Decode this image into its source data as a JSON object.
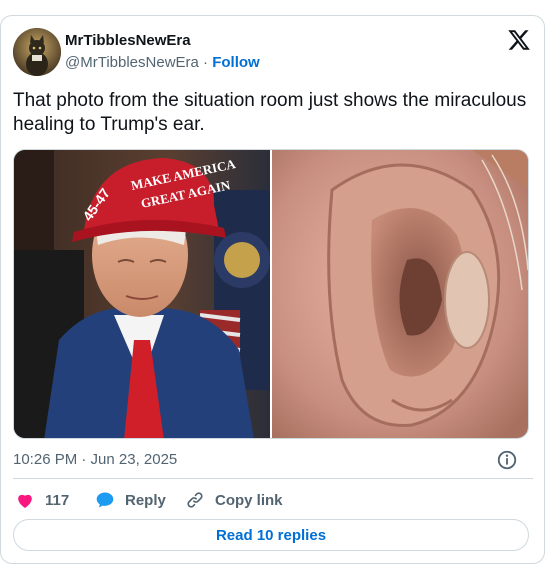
{
  "author": {
    "display_name": "MrTibblesNewEra",
    "handle": "@MrTibblesNewEra",
    "separator": "·",
    "follow_label": "Follow"
  },
  "tweet": {
    "text": "That photo from the situation room just shows the miraculous healing to Trump's ear."
  },
  "media": {
    "left_image_icon": "photo-man-red-cap-icon",
    "cap_line1": "MAKE AMERICA",
    "cap_line2": "GREAT AGAIN",
    "cap_side": "45-47",
    "right_image_icon": "photo-ear-closeup-icon"
  },
  "meta": {
    "timestamp": "10:26 PM · Jun 23, 2025"
  },
  "actions": {
    "like_count": "117",
    "reply_label": "Reply",
    "copy_link_label": "Copy link"
  },
  "footer": {
    "read_replies_label": "Read 10 replies"
  },
  "colors": {
    "accent": "#006fd6",
    "like": "#f91880",
    "reply": "#1d9bf0",
    "text": "#0f1419",
    "muted": "#536471",
    "border": "#cfd9de"
  }
}
